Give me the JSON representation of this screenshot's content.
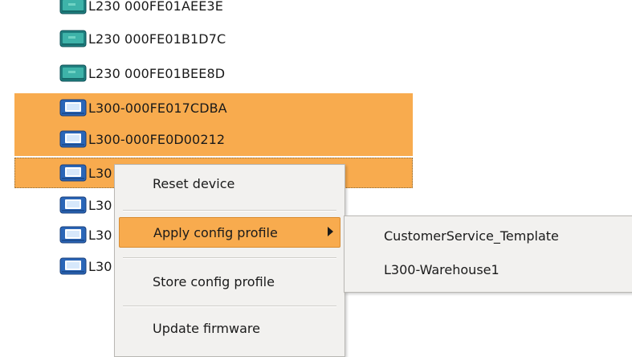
{
  "devices": [
    {
      "label": "L230 000FE01AEE3E",
      "icon": "green-terminal-icon"
    },
    {
      "label": "L230 000FE01B1D7C",
      "icon": "green-terminal-icon"
    },
    {
      "label": "L230 000FE01BEE8D",
      "icon": "green-terminal-icon"
    },
    {
      "label": "L300-000FE017CDBA",
      "icon": "blue-terminal-icon"
    },
    {
      "label": "L300-000FE0D00212",
      "icon": "blue-terminal-icon"
    },
    {
      "label": "L30",
      "icon": "blue-terminal-icon"
    },
    {
      "label": "L30",
      "icon": "blue-terminal-icon"
    },
    {
      "label": "L30",
      "icon": "blue-terminal-icon"
    },
    {
      "label": "L30",
      "icon": "blue-terminal-icon"
    }
  ],
  "context_menu": {
    "reset": "Reset device",
    "apply": "Apply config profile",
    "store": "Store config profile",
    "update": "Update firmware"
  },
  "submenu": {
    "items": [
      "CustomerService_Template",
      "L300-Warehouse1"
    ]
  },
  "colors": {
    "selection": "#f8ab4e",
    "menu_bg": "#f2f1ef"
  }
}
